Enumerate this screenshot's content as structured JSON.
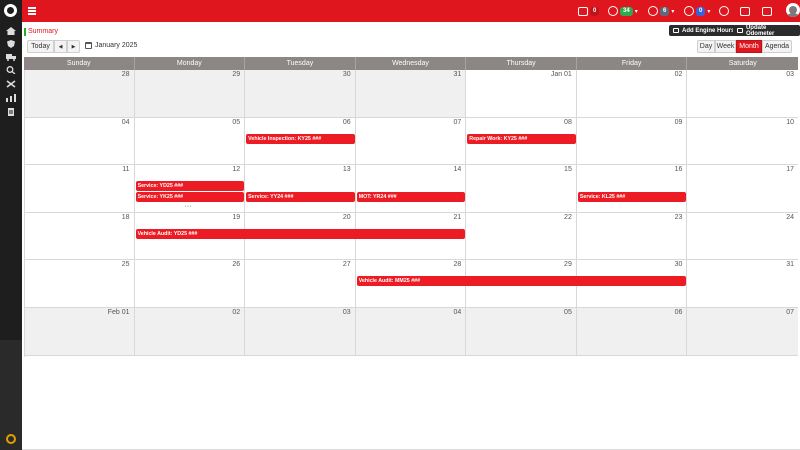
{
  "sidebar": {
    "icons": [
      "home-icon",
      "shield-icon",
      "truck-icon",
      "wrench-icon",
      "chart-icon",
      "document-icon",
      "power-icon"
    ]
  },
  "topbar": {
    "badges": [
      {
        "icon": "truck-icon",
        "value": "0",
        "color": "#c0141b"
      },
      {
        "icon": "message-icon",
        "value": "34",
        "color": "#2fa84f"
      },
      {
        "icon": "clock-icon",
        "value": "6",
        "color": "#5b6b7b"
      },
      {
        "icon": "help-icon",
        "value": "0",
        "color": "#3a63d9"
      }
    ]
  },
  "summary": "Summary",
  "actions": {
    "add_engine_hours": "Add Engine Hours",
    "update_odometer": "Update Odometer"
  },
  "toolbar": {
    "today": "Today",
    "prev": "◀",
    "next": "▶",
    "title": "January 2025",
    "views": [
      "Day",
      "Week",
      "Month",
      "Agenda"
    ],
    "active_view": "Month"
  },
  "calendar": {
    "days_of_week": [
      "Sunday",
      "Monday",
      "Tuesday",
      "Wednesday",
      "Thursday",
      "Friday",
      "Saturday"
    ],
    "weeks": [
      [
        {
          "label": "28",
          "other": true
        },
        {
          "label": "29",
          "other": true
        },
        {
          "label": "30",
          "other": true
        },
        {
          "label": "31",
          "other": true
        },
        {
          "label": "Jan 01",
          "other": false
        },
        {
          "label": "02",
          "other": false
        },
        {
          "label": "03",
          "other": false
        }
      ],
      [
        {
          "label": "04",
          "other": false
        },
        {
          "label": "05",
          "other": false
        },
        {
          "label": "06",
          "other": false
        },
        {
          "label": "07",
          "other": false
        },
        {
          "label": "08",
          "other": false
        },
        {
          "label": "09",
          "other": false
        },
        {
          "label": "10",
          "other": false
        }
      ],
      [
        {
          "label": "11",
          "other": false
        },
        {
          "label": "12",
          "other": false
        },
        {
          "label": "13",
          "other": false
        },
        {
          "label": "14",
          "other": false
        },
        {
          "label": "15",
          "other": false
        },
        {
          "label": "16",
          "other": false
        },
        {
          "label": "17",
          "other": false
        }
      ],
      [
        {
          "label": "18",
          "other": false
        },
        {
          "label": "19",
          "other": false
        },
        {
          "label": "20",
          "other": false
        },
        {
          "label": "21",
          "other": false
        },
        {
          "label": "22",
          "other": false
        },
        {
          "label": "23",
          "other": false
        },
        {
          "label": "24",
          "other": false
        }
      ],
      [
        {
          "label": "25",
          "other": false
        },
        {
          "label": "26",
          "other": false
        },
        {
          "label": "27",
          "other": false
        },
        {
          "label": "28",
          "other": false
        },
        {
          "label": "29",
          "other": false
        },
        {
          "label": "30",
          "other": false
        },
        {
          "label": "31",
          "other": false
        }
      ],
      [
        {
          "label": "Feb 01",
          "other": true
        },
        {
          "label": "02",
          "other": true
        },
        {
          "label": "03",
          "other": true
        },
        {
          "label": "04",
          "other": true
        },
        {
          "label": "05",
          "other": true
        },
        {
          "label": "06",
          "other": true
        },
        {
          "label": "07",
          "other": true
        }
      ]
    ],
    "events": [
      {
        "title": "Vehicle Inspection: KY25 ###",
        "week": 1,
        "start": 2,
        "span": 1,
        "row": 0
      },
      {
        "title": "Repair Work: KY25 ###",
        "week": 1,
        "start": 4,
        "span": 1,
        "row": 0
      },
      {
        "title": "Service: YD25 ###",
        "week": 2,
        "start": 1,
        "span": 1,
        "row": 0
      },
      {
        "title": "Service: YK25 ###",
        "week": 2,
        "start": 1,
        "span": 1,
        "row": 1
      },
      {
        "title": "Service: YY24 ###",
        "week": 2,
        "start": 2,
        "span": 1,
        "row": 1
      },
      {
        "title": "MOT: YR24 ###",
        "week": 2,
        "start": 3,
        "span": 1,
        "row": 1
      },
      {
        "title": "Service: KL25 ###",
        "week": 2,
        "start": 5,
        "span": 1,
        "row": 1
      },
      {
        "title": "Vehicle Audit: YD25 ###",
        "week": 3,
        "start": 1,
        "span": 3,
        "row": 0
      },
      {
        "title": "Vehicle Audit: MM25 ###",
        "week": 4,
        "start": 3,
        "span": 3,
        "row": 0
      }
    ],
    "more_link": {
      "week": 2,
      "day": 1,
      "text": "···"
    }
  }
}
